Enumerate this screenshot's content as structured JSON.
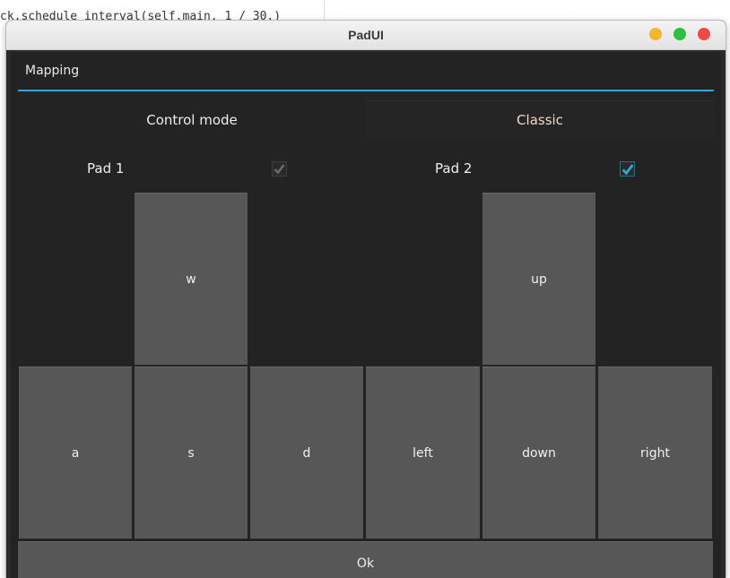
{
  "editor": {
    "top_line": "ck.schedule_interval(self.main, 1 / 30.)"
  },
  "window": {
    "title": "PadUI"
  },
  "tab": {
    "label": "Mapping",
    "accent_color": "#33a7d8"
  },
  "control_mode": {
    "label": "Control mode",
    "value": "Classic"
  },
  "pads": [
    {
      "label": "Pad 1",
      "checked": true,
      "enabled": false,
      "keys": {
        "up": "w",
        "left": "a",
        "down": "s",
        "right": "d"
      }
    },
    {
      "label": "Pad 2",
      "checked": true,
      "enabled": true,
      "keys": {
        "up": "up",
        "left": "left",
        "down": "down",
        "right": "right"
      }
    }
  ],
  "ok_label": "Ok"
}
